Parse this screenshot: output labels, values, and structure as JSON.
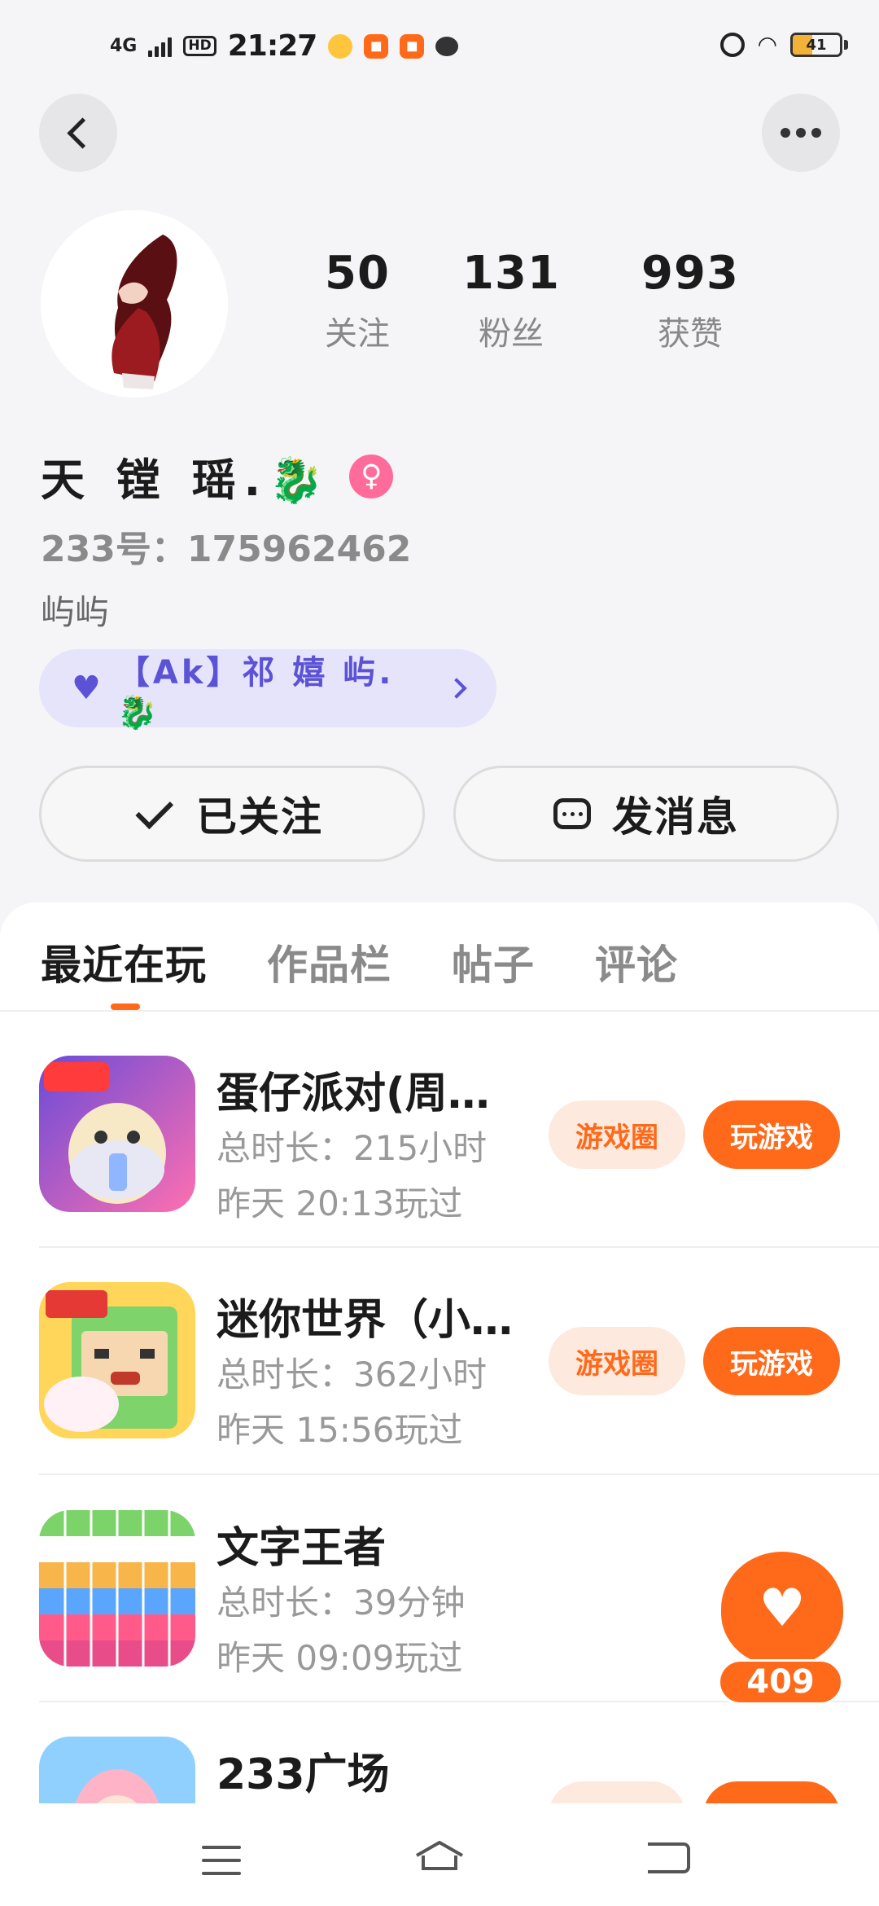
{
  "status_bar": {
    "network": "4G",
    "hd": "HD",
    "time": "21:27",
    "battery": "41",
    "battery_level": 0.41
  },
  "profile": {
    "stats": [
      {
        "value": "50",
        "label": "关注"
      },
      {
        "value": "131",
        "label": "粉丝"
      },
      {
        "value": "993",
        "label": "获赞"
      }
    ],
    "name": "天 镗 瑶.🐉",
    "gender_symbol": "♀",
    "id_text": "233号：175962462",
    "bio": "屿屿",
    "guild": "【Ak】祁 嬉 屿.🐉"
  },
  "actions": {
    "follow_label": "已关注",
    "message_label": "发消息"
  },
  "tabs": [
    "最近在玩",
    "作品栏",
    "帖子",
    "评论"
  ],
  "games": [
    {
      "title": "蛋仔派对(周…",
      "duration": "总时长：215小时",
      "last_played": "昨天 20:13玩过",
      "circle_label": "游戏圈",
      "play_label": "玩游戏"
    },
    {
      "title": "迷你世界（小…",
      "duration": "总时长：362小时",
      "last_played": "昨天 15:56玩过",
      "circle_label": "游戏圈",
      "play_label": "玩游戏"
    },
    {
      "title": "文字王者",
      "duration": "总时长：39分钟",
      "last_played": "昨天 09:09玩过"
    },
    {
      "title": "233广场"
    }
  ],
  "float_like": {
    "count": "409"
  },
  "colors": {
    "accent": "#ff6a1a",
    "guild": "#5b52d6",
    "guild_bg": "#e6e4fb"
  }
}
